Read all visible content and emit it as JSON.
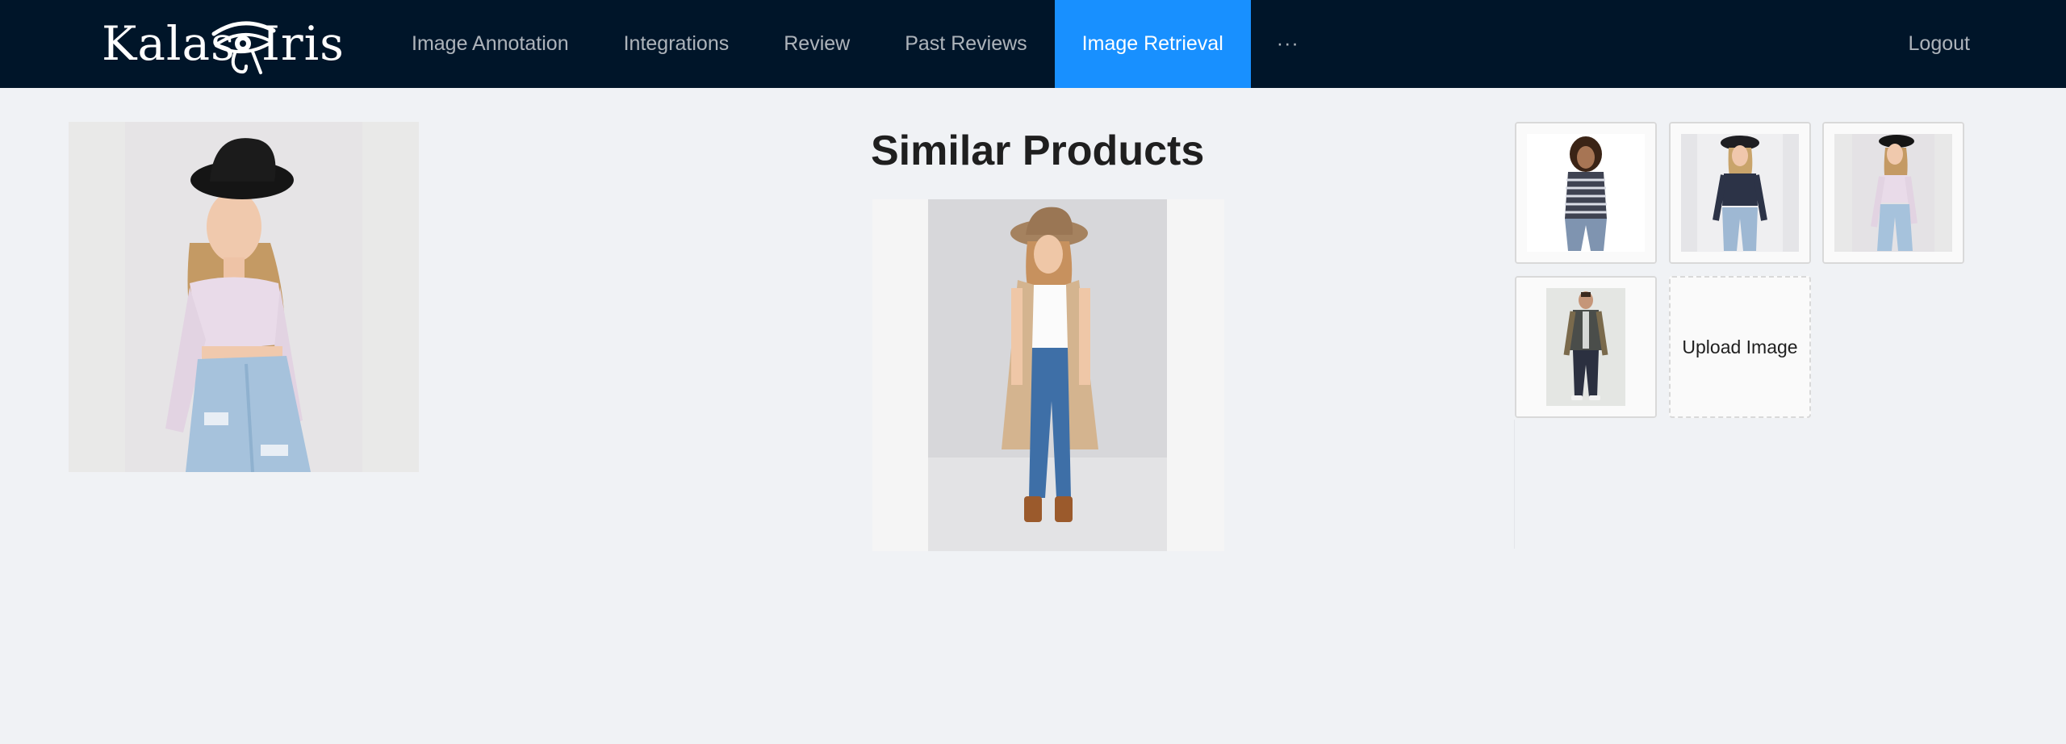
{
  "app": {
    "logo_left": "Kalas",
    "logo_right": "Iris"
  },
  "nav": {
    "items": [
      {
        "label": "Image Annotation",
        "active": false
      },
      {
        "label": "Integrations",
        "active": false
      },
      {
        "label": "Review",
        "active": false
      },
      {
        "label": "Past Reviews",
        "active": false
      },
      {
        "label": "Image Retrieval",
        "active": true
      },
      {
        "label": "···",
        "active": false
      }
    ],
    "logout_label": "Logout"
  },
  "query_image": {
    "icon": "woman-lace-top-jeans-photo"
  },
  "results": {
    "title": "Similar Products",
    "icon": "woman-vest-jeans-photo"
  },
  "gallery": {
    "thumbnails": [
      {
        "icon": "woman-striped-top-photo"
      },
      {
        "icon": "woman-navy-top-photo"
      },
      {
        "icon": "woman-lace-top-photo"
      },
      {
        "icon": "man-jacket-photo"
      }
    ],
    "upload_label": "Upload Image"
  },
  "colors": {
    "header_bg": "#001529",
    "active_nav": "#1890ff",
    "page_bg": "#f0f2f5"
  }
}
